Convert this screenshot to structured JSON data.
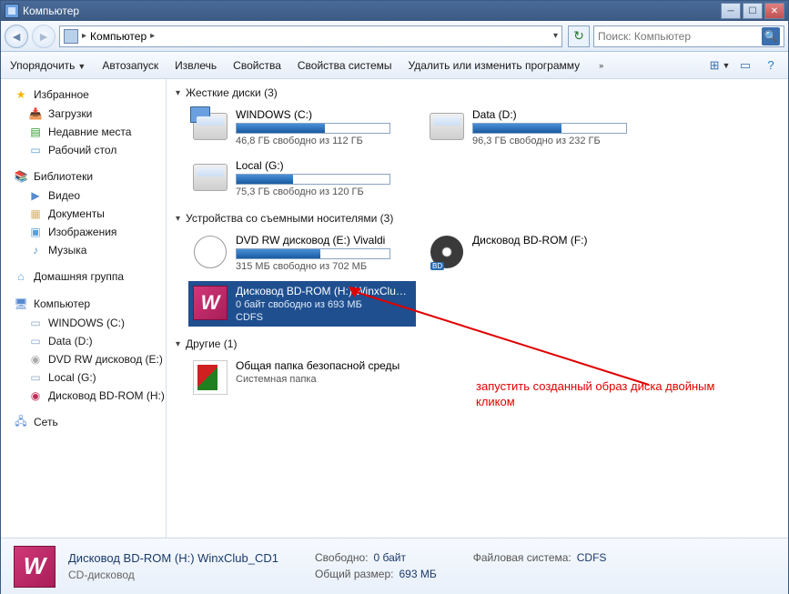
{
  "window": {
    "title": "Компьютер"
  },
  "nav": {
    "breadcrumb": "Компьютер",
    "search_placeholder": "Поиск: Компьютер"
  },
  "toolbar": {
    "organize": "Упорядочить",
    "autoplay": "Автозапуск",
    "extract": "Извлечь",
    "properties": "Свойства",
    "sys_properties": "Свойства системы",
    "uninstall": "Удалить или изменить программу"
  },
  "sidebar": {
    "favorites": {
      "label": "Избранное",
      "items": [
        "Загрузки",
        "Недавние места",
        "Рабочий стол"
      ]
    },
    "libraries": {
      "label": "Библиотеки",
      "items": [
        "Видео",
        "Документы",
        "Изображения",
        "Музыка"
      ]
    },
    "homegroup": {
      "label": "Домашняя группа"
    },
    "computer": {
      "label": "Компьютер",
      "items": [
        "WINDOWS (C:)",
        "Data (D:)",
        "DVD RW дисковод (E:) Vivaldi",
        "Local (G:)",
        "Дисковод BD-ROM (H:) WinxClub_CD1"
      ]
    },
    "network": {
      "label": "Сеть"
    }
  },
  "groups": {
    "hdd": {
      "label": "Жесткие диски (3)"
    },
    "removable": {
      "label": "Устройства со съемными носителями (3)"
    },
    "other": {
      "label": "Другие (1)"
    }
  },
  "drives": {
    "c": {
      "name": "WINDOWS (C:)",
      "free": "46,8 ГБ свободно из 112 ГБ",
      "pct": 58
    },
    "d": {
      "name": "Data (D:)",
      "free": "96,3 ГБ свободно из 232 ГБ",
      "pct": 58
    },
    "g": {
      "name": "Local (G:)",
      "free": "75,3 ГБ свободно из 120 ГБ",
      "pct": 37
    },
    "e": {
      "name": "DVD RW дисковод (E:) Vivaldi",
      "free": "315 МБ свободно из 702 МБ",
      "pct": 55
    },
    "f": {
      "name": "Дисковод BD-ROM (F:)"
    },
    "h": {
      "name": "Дисковод BD-ROM (H:) WinxClub_CD1",
      "free": "0 байт свободно из 693 МБ",
      "fs": "CDFS"
    },
    "kasp": {
      "name": "Общая папка безопасной среды",
      "type": "Системная папка"
    }
  },
  "annotation": "запустить созданный образ диска двойным кликом",
  "details": {
    "title": "Дисковод BD-ROM (H:) WinxClub_CD1",
    "type": "CD-дисковод",
    "free_label": "Свободно:",
    "free_val": "0 байт",
    "size_label": "Общий размер:",
    "size_val": "693 МБ",
    "fs_label": "Файловая система:",
    "fs_val": "CDFS"
  }
}
